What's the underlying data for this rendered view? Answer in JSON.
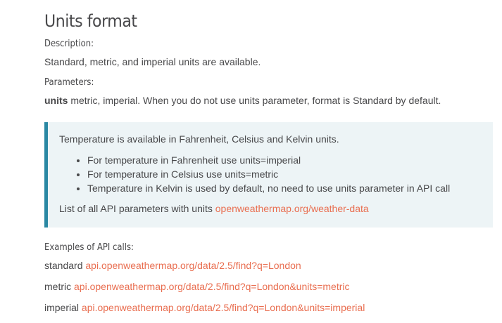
{
  "section": {
    "title": "Units format",
    "description_label": "Description:",
    "description_text": "Standard, metric, and imperial units are available.",
    "parameters_label": "Parameters:",
    "param_name": "units",
    "param_text": " metric, imperial. When you do not use units parameter, format is Standard by default."
  },
  "note": {
    "intro": "Temperature is available in Fahrenheit, Celsius and Kelvin units.",
    "items": [
      "For temperature in Fahrenheit use units=imperial",
      "For temperature in Celsius use units=metric",
      "Temperature in Kelvin is used by default, no need to use units parameter in API call"
    ],
    "outro_text": "List of all API parameters with units ",
    "outro_link": "openweathermap.org/weather-data",
    "accent_color": "#2a88a3",
    "background_color": "#edf4f6"
  },
  "examples": {
    "label": "Examples of API calls:",
    "calls": [
      {
        "name": "standard",
        "link": "api.openweathermap.org/data/2.5/find?q=London"
      },
      {
        "name": "metric",
        "link": "api.openweathermap.org/data/2.5/find?q=London&units=metric"
      },
      {
        "name": "imperial",
        "link": "api.openweathermap.org/data/2.5/find?q=London&units=imperial"
      }
    ]
  },
  "colors": {
    "link": "#e96e50",
    "text": "#48484a"
  }
}
